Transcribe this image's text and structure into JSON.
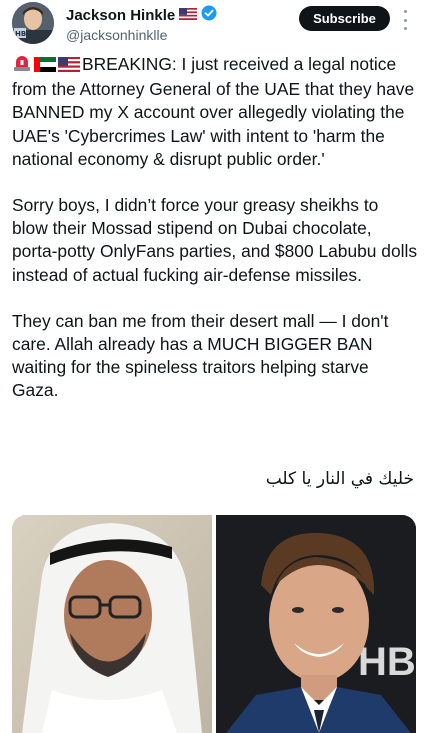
{
  "author": {
    "display_name": "Jackson Hinkle",
    "handle": "@jacksonhinklle",
    "flag_icon": "us-flag-icon",
    "verified_icon": "verified-badge-icon",
    "verified_color": "#1d9bf0"
  },
  "actions": {
    "subscribe_label": "Subscribe",
    "more_icon": "more-vertical-icon"
  },
  "post": {
    "lead_emojis": [
      "police-light-emoji",
      "uae-flag-emoji",
      "us-flag-emoji"
    ],
    "paragraphs": [
      "BREAKING: I just received a legal notice from the Attorney General of the UAE that they have BANNED my X account over allegedly violating the UAE's 'Cybercrimes Law' with intent to 'harm the national economy & disrupt public order.'",
      "Sorry boys, I didn’t force your greasy sheikhs to blow their Mossad stipend on Dubai chocolate, porta-potty OnlyFans parties, and $800 Labubu dolls instead of actual fucking air-defense missiles.",
      "They can ban me from their desert mall — I don't care. Allah already has a MUCH BIGGER BAN waiting for the spineless traitors helping starve Gaza."
    ],
    "arabic_line": "خليك في النار يا كلب"
  },
  "media": {
    "images": [
      "photo-of-man-in-white-ghutra",
      "photo-of-smiling-man-in-suit"
    ]
  }
}
